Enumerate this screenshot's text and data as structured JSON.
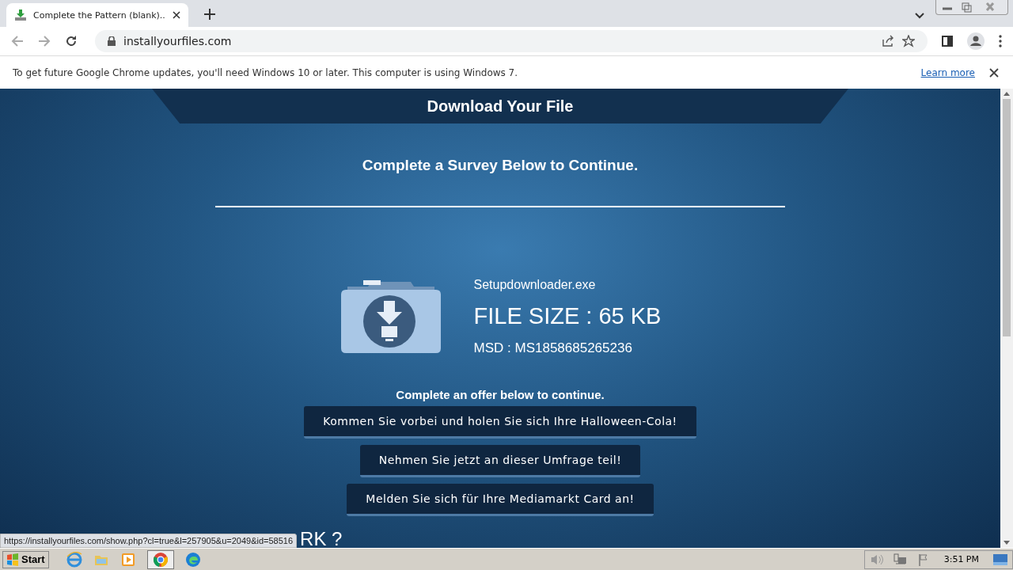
{
  "browser": {
    "tab": {
      "title": "Complete the Pattern (blank)..",
      "selected": true
    },
    "address": "installyourfiles.com"
  },
  "infobar": {
    "message": "To get future Google Chrome updates, you'll need Windows 10 or later. This computer is using Windows 7.",
    "link": "Learn more"
  },
  "page": {
    "header": "Download Your File",
    "subtitle": "Complete a Survey Below to Continue.",
    "file": {
      "name": "Setupdownloader.exe",
      "size": "FILE SIZE : 65 KB",
      "msd": "MSD : MS1858685265236"
    },
    "offer_prompt": "Complete an offer below to continue.",
    "offers": [
      "Kommen Sie vorbei und holen Sie sich Ihre Halloween-Cola!",
      "Nehmen Sie jetzt an dieser Umfrage teil!",
      "Melden Sie sich für Ihre Mediamarkt Card an!"
    ],
    "partial_heading": "RK ?"
  },
  "status_url": "https://installyourfiles.com/show.php?cl=true&l=257905&u=2049&id=58516",
  "taskbar": {
    "start": "Start",
    "clock": "3:51 PM"
  }
}
